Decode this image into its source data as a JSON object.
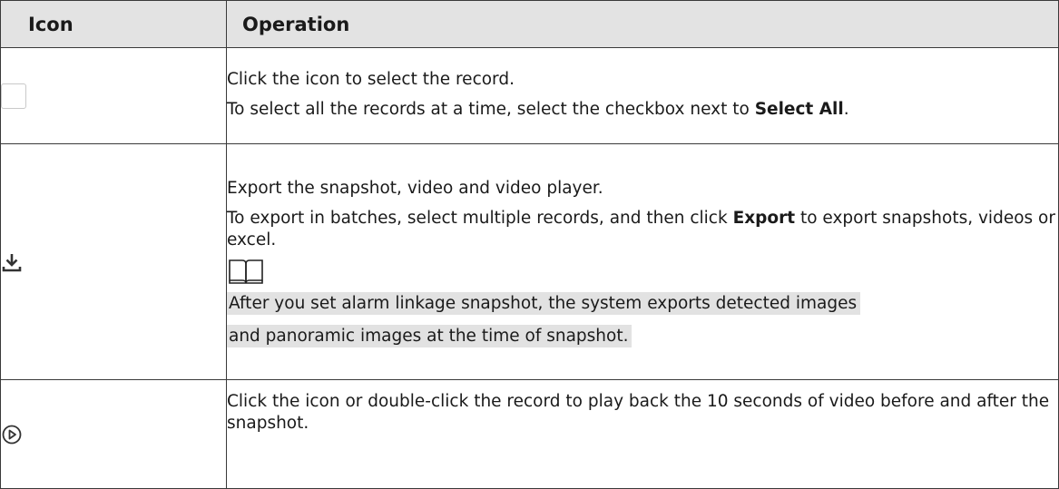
{
  "table": {
    "headers": {
      "icon": "Icon",
      "operation": "Operation"
    },
    "rows": [
      {
        "icon": "checkbox-icon",
        "lines": [
          {
            "text": "Click the icon to select the record."
          },
          {
            "pre": "To select all the records at a time, select the checkbox next to ",
            "bold": "Select All",
            "post": "."
          }
        ]
      },
      {
        "icon": "download-icon",
        "lines": [
          {
            "text": "Export the snapshot, video and video player."
          },
          {
            "pre": "To export in batches, select multiple records, and then click ",
            "bold": "Export",
            "post": " to export snapshots, videos or excel."
          }
        ],
        "note_icon": "book-note-icon",
        "note_lines": [
          "After you set alarm linkage snapshot, the system exports detected images",
          "and panoramic images at the time of snapshot."
        ]
      },
      {
        "icon": "play-circle-icon",
        "lines": [
          {
            "text": "Click the icon or double-click the record to play back the 10 seconds of video before and after the snapshot."
          }
        ]
      }
    ]
  },
  "colors": {
    "header_bg": "#e3e3e3",
    "note_highlight": "#e2e2e2",
    "border": "#3a3a3a"
  }
}
